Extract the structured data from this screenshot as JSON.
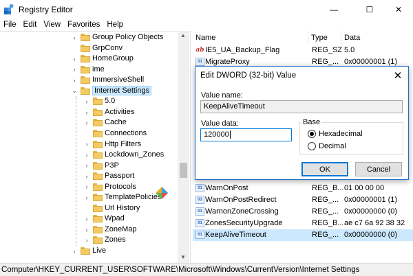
{
  "window": {
    "title": "Registry Editor",
    "controls": {
      "minimize": "—",
      "maximize": "☐",
      "close": "✕"
    }
  },
  "menu": [
    "File",
    "Edit",
    "View",
    "Favorites",
    "Help"
  ],
  "tree": {
    "items": [
      {
        "label": "Group Policy Objects",
        "expander": "›"
      },
      {
        "label": "GrpConv",
        "expander": ""
      },
      {
        "label": "HomeGroup",
        "expander": "›"
      },
      {
        "label": "ime",
        "expander": "›"
      },
      {
        "label": "ImmersiveShell",
        "expander": "›"
      },
      {
        "label": "Internet Settings",
        "expander": "⌄",
        "selected": true
      },
      {
        "label": "5.0",
        "expander": "›"
      },
      {
        "label": "Activities",
        "expander": "›"
      },
      {
        "label": "Cache",
        "expander": "›"
      },
      {
        "label": "Connections",
        "expander": ""
      },
      {
        "label": "Http Filters",
        "expander": "›"
      },
      {
        "label": "Lockdown_Zones",
        "expander": "›"
      },
      {
        "label": "P3P",
        "expander": "›"
      },
      {
        "label": "Passport",
        "expander": "›"
      },
      {
        "label": "Protocols",
        "expander": "›"
      },
      {
        "label": "TemplatePolicies",
        "expander": "›"
      },
      {
        "label": "Url History",
        "expander": ""
      },
      {
        "label": "Wpad",
        "expander": "›"
      },
      {
        "label": "ZoneMap",
        "expander": "›"
      },
      {
        "label": "Zones",
        "expander": "›"
      },
      {
        "label": "Live",
        "expander": "›"
      }
    ]
  },
  "values": {
    "headers": {
      "name": "Name",
      "type": "Type",
      "data": "Data"
    },
    "rows": [
      {
        "icon": "ab",
        "name": "IE5_UA_Backup_Flag",
        "type": "REG_SZ",
        "data": "5.0"
      },
      {
        "icon": "01",
        "name": "MigrateProxy",
        "type": "REG_...",
        "data": "0x00000001 (1)"
      },
      {
        "icon": "01",
        "name": "WarnOnPost",
        "type": "REG_B...",
        "data": "01 00 00 00"
      },
      {
        "icon": "01",
        "name": "WarnOnPostRedirect",
        "type": "REG_...",
        "data": "0x00000001 (1)"
      },
      {
        "icon": "01",
        "name": "WarnonZoneCrossing",
        "type": "REG_...",
        "data": "0x00000000 (0)"
      },
      {
        "icon": "01",
        "name": "ZonesSecurityUpgrade",
        "type": "REG_B...",
        "data": "ae c7 6a 92 38 32"
      },
      {
        "icon": "01",
        "name": "KeepAliveTimeout",
        "type": "REG_...",
        "data": "0x00000000 (0)",
        "selected": true
      }
    ]
  },
  "status_bar": {
    "path": "Computer\\HKEY_CURRENT_USER\\SOFTWARE\\Microsoft\\Windows\\CurrentVersion\\Internet Settings"
  },
  "dialog": {
    "title": "Edit DWORD (32-bit) Value",
    "close_glyph": "✕",
    "value_name_label": "Value name:",
    "value_name": "KeepAliveTimeout",
    "value_data_label": "Value data:",
    "value_data": "120000",
    "base_label": "Base",
    "hex_label": "Hexadecimal",
    "dec_label": "Decimal",
    "selected_base": "Hexadecimal",
    "ok_label": "OK",
    "cancel_label": "Cancel"
  },
  "colors": {
    "accent": "#0078d7",
    "selection": "#cce8ff",
    "folder": "#f3cb62"
  }
}
